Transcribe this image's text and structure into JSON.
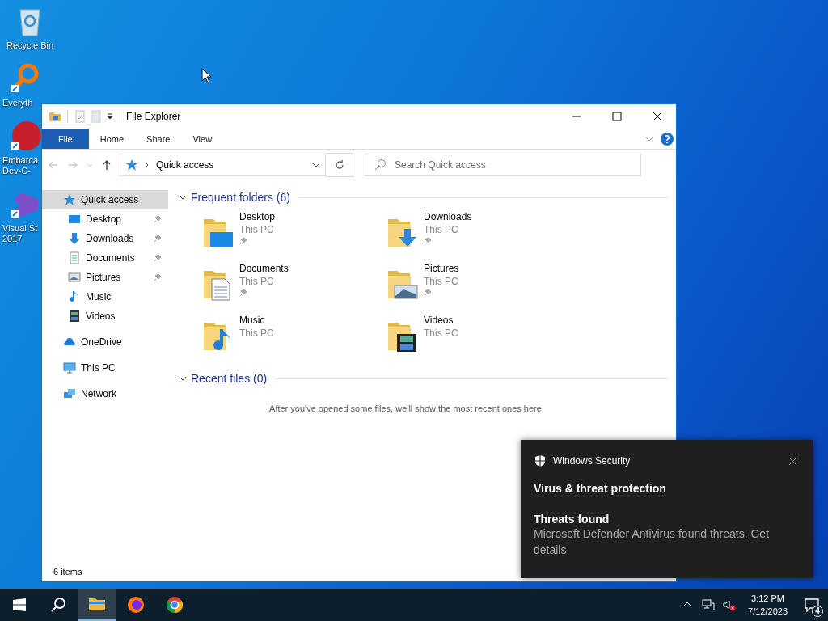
{
  "desktop_icons": [
    {
      "kind": "recycle",
      "lines": [
        "Recycle Bin"
      ]
    },
    {
      "kind": "magnifier",
      "lines": [
        "Everyth"
      ]
    },
    {
      "kind": "devcpp",
      "lines": [
        "Embarca",
        "Dev-C-"
      ]
    },
    {
      "kind": "vstudio",
      "lines": [
        "Visual St",
        "2017"
      ]
    }
  ],
  "window": {
    "title": "File Explorer",
    "ribbon_tabs": [
      {
        "label": "File",
        "kind": "menu"
      },
      {
        "label": "Home",
        "kind": "tab"
      },
      {
        "label": "Share",
        "kind": "tab"
      },
      {
        "label": "View",
        "kind": "tab"
      }
    ],
    "address": {
      "path": "Quick access"
    },
    "search": {
      "placeholder": "Search Quick access"
    },
    "sidebar": {
      "items": [
        {
          "label": "Quick access",
          "kind": "star",
          "selected": true,
          "children": [
            {
              "label": "Desktop",
              "kind": "desktop",
              "pinned": true,
              "selected": false
            },
            {
              "label": "Downloads",
              "kind": "download",
              "pinned": true,
              "selected": false
            },
            {
              "label": "Documents",
              "kind": "document",
              "pinned": true,
              "selected": false
            },
            {
              "label": "Pictures",
              "kind": "picture",
              "pinned": true,
              "selected": false
            },
            {
              "label": "Music",
              "kind": "music",
              "pinned": false,
              "selected": false
            },
            {
              "label": "Videos",
              "kind": "video",
              "pinned": false,
              "selected": false
            }
          ]
        },
        {
          "label": "OneDrive",
          "kind": "cloud",
          "selected": false
        },
        {
          "label": "This PC",
          "kind": "pc",
          "selected": false
        },
        {
          "label": "Network",
          "kind": "network",
          "selected": false
        }
      ]
    },
    "sections": [
      {
        "title": "Frequent folders (6)",
        "expanded": true,
        "items": [
          {
            "name": "Desktop",
            "location": "This PC",
            "kind": "desktop",
            "pinned": true
          },
          {
            "name": "Downloads",
            "location": "This PC",
            "kind": "download",
            "pinned": true
          },
          {
            "name": "Documents",
            "location": "This PC",
            "kind": "document",
            "pinned": true
          },
          {
            "name": "Pictures",
            "location": "This PC",
            "kind": "picture",
            "pinned": true
          },
          {
            "name": "Music",
            "location": "This PC",
            "kind": "music",
            "pinned": false
          },
          {
            "name": "Videos",
            "location": "This PC",
            "kind": "video",
            "pinned": false
          }
        ]
      },
      {
        "title": "Recent files (0)",
        "expanded": true,
        "empty_message": "After you've opened some files, we'll show the most recent ones here."
      }
    ],
    "status_bar": "6 items"
  },
  "toast": {
    "app": "Windows Security",
    "title": "Virus & threat protection",
    "heading": "Threats found",
    "body": "Microsoft Defender Antivirus found threats. Get details."
  },
  "taskbar": {
    "apps": [
      {
        "kind": "explorer",
        "active": true
      },
      {
        "kind": "firefox",
        "active": false
      },
      {
        "kind": "chrome",
        "active": false
      }
    ],
    "time": "3:12 PM",
    "date": "7/12/2023",
    "notifications": "4"
  }
}
